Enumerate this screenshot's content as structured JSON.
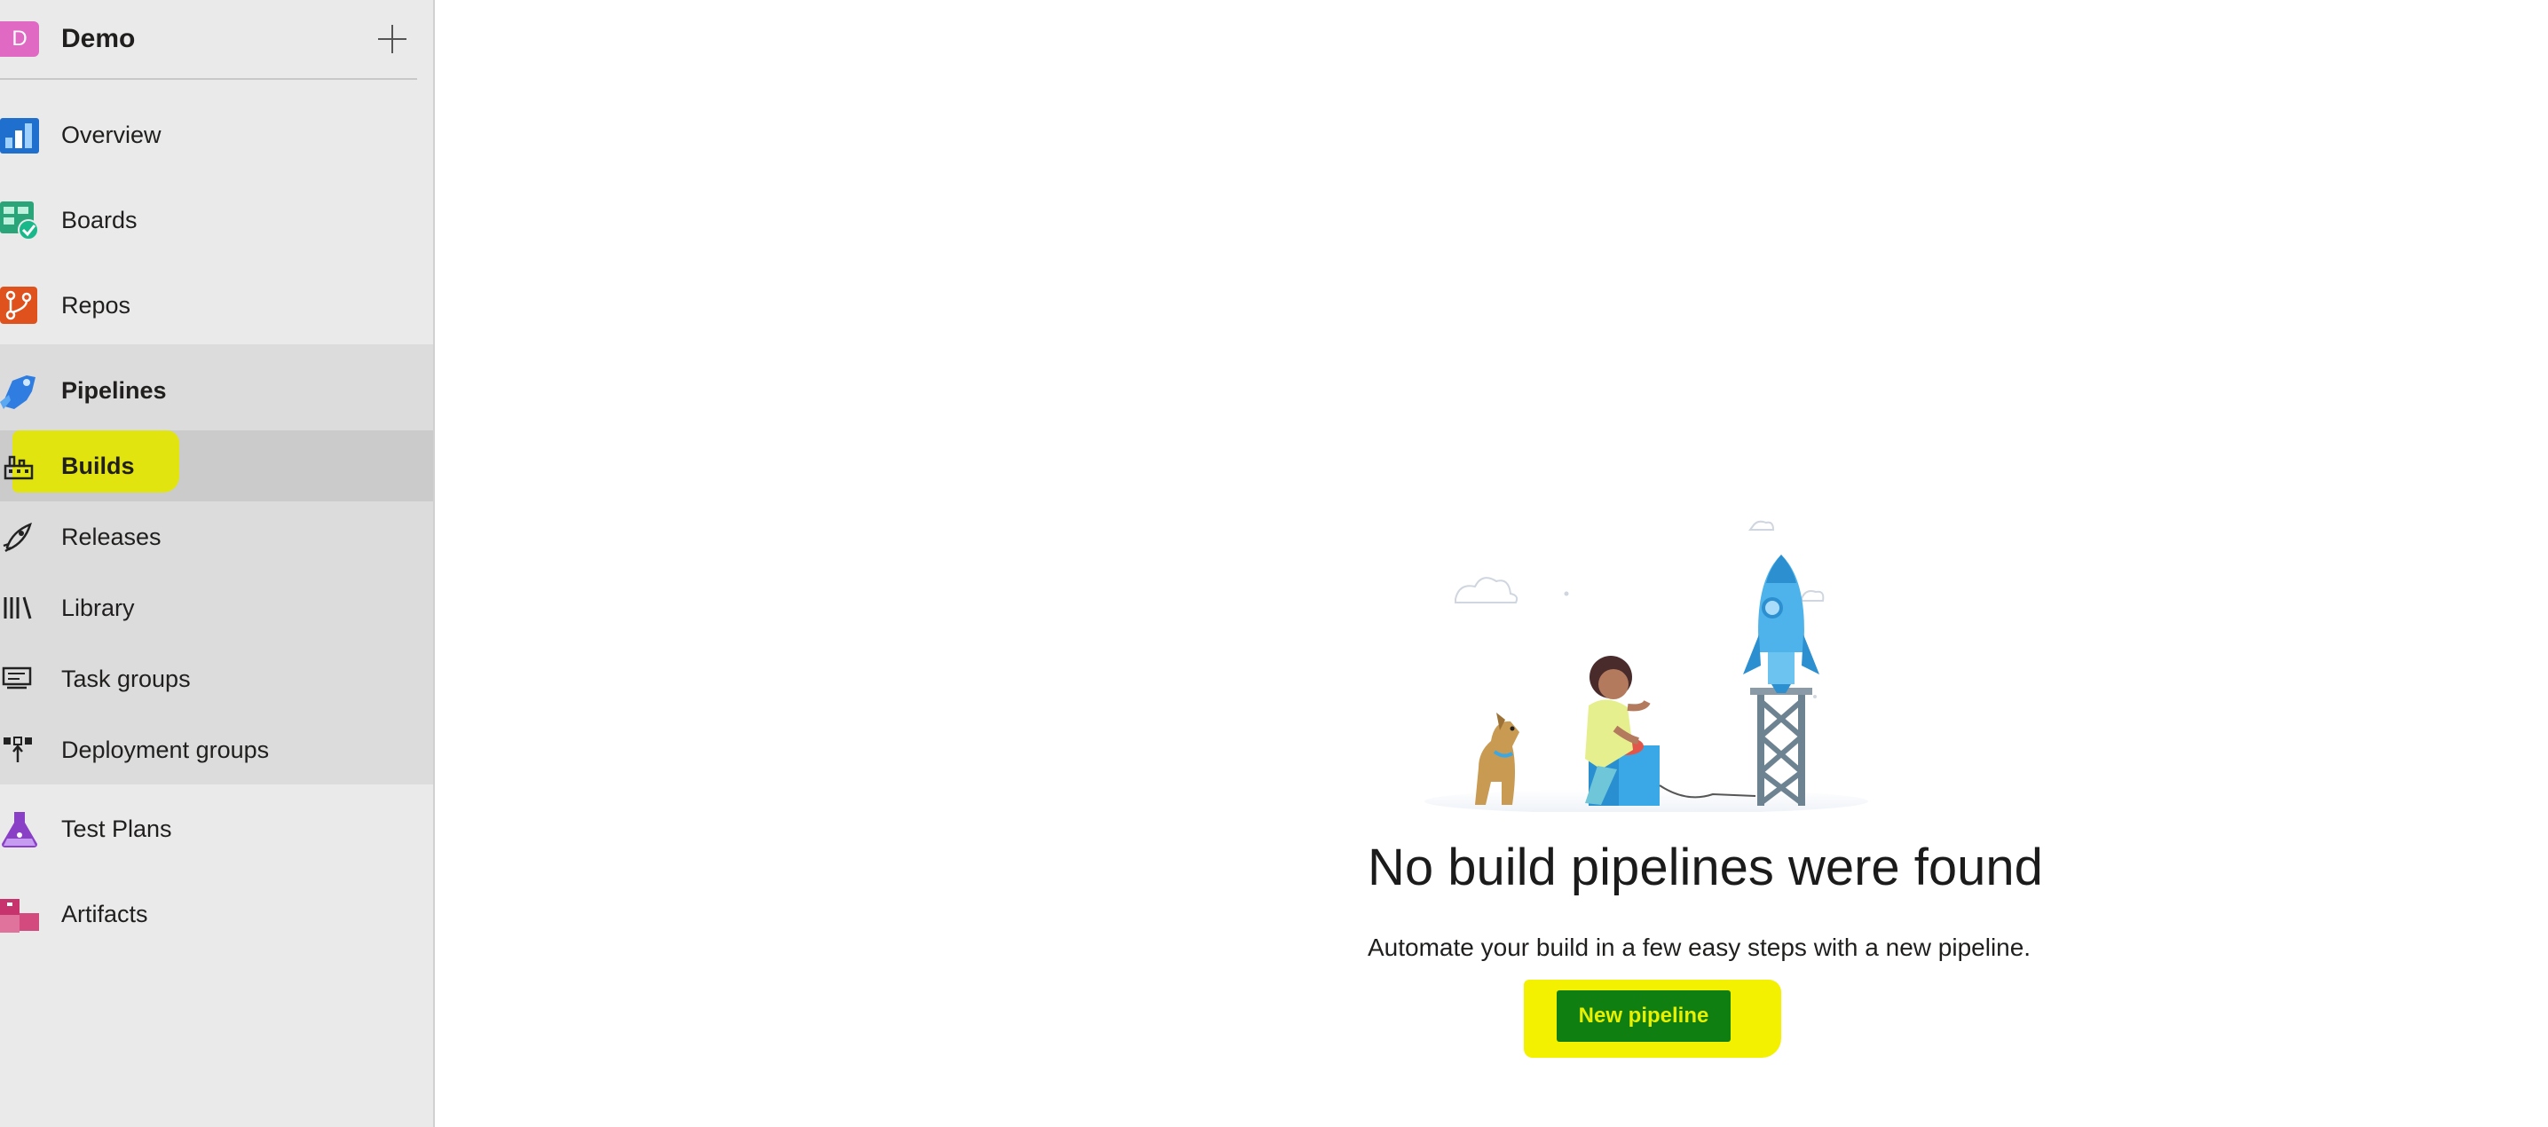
{
  "project": {
    "avatar_letter": "D",
    "name": "Demo"
  },
  "nav": {
    "overview": "Overview",
    "boards": "Boards",
    "repos": "Repos",
    "pipelines": "Pipelines",
    "builds": "Builds",
    "releases": "Releases",
    "library": "Library",
    "task_groups": "Task groups",
    "deployment_groups": "Deployment groups",
    "test_plans": "Test Plans",
    "artifacts": "Artifacts"
  },
  "empty_state": {
    "title": "No build pipelines were found",
    "description": "Automate your build in a few easy steps with a new pipeline.",
    "button_label": "New pipeline"
  },
  "colors": {
    "highlight": "#e4e600",
    "button": "#0f7f12",
    "avatar": "#e06ac3"
  }
}
